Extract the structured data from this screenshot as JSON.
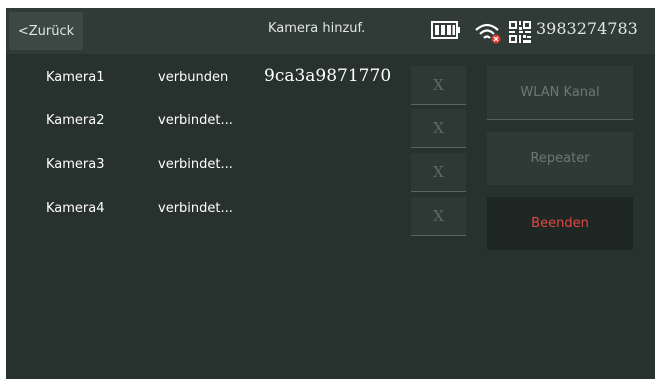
{
  "header": {
    "back_label": "<Zurück",
    "title": "Kamera hinzuf.",
    "device_id": "3983274783",
    "icons": [
      "battery-icon",
      "wifi-icon",
      "qr-code-icon"
    ]
  },
  "cameras": [
    {
      "name": "Kamera1",
      "status": "verbunden",
      "uid": "9ca3a9871770",
      "remove_label": "X"
    },
    {
      "name": "Kamera2",
      "status": "verbindet...",
      "uid": "",
      "remove_label": "X"
    },
    {
      "name": "Kamera3",
      "status": "verbindet...",
      "uid": "",
      "remove_label": "X"
    },
    {
      "name": "Kamera4",
      "status": "verbindet...",
      "uid": "",
      "remove_label": "X"
    }
  ],
  "actions": {
    "wlan_label": "WLAN Kanal",
    "repeater_label": "Repeater",
    "exit_label": "Beenden"
  },
  "colors": {
    "background": "#27312e",
    "exit_text": "#e04845",
    "wifi_alert": "#e03a2c"
  }
}
